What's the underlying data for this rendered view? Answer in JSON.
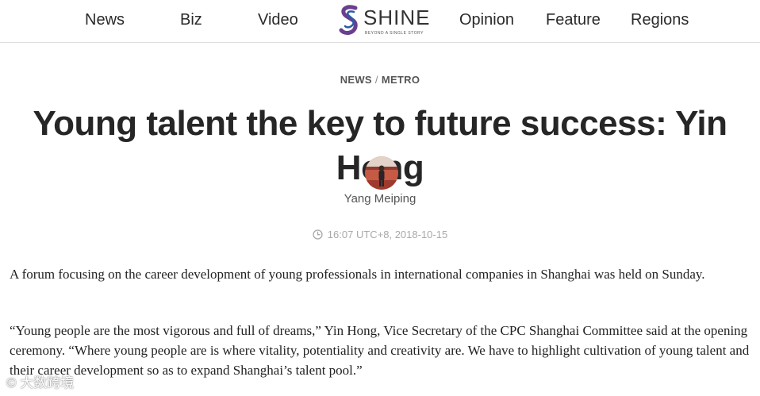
{
  "nav": {
    "left": [
      "News",
      "Biz",
      "Video"
    ],
    "right": [
      "Opinion",
      "Feature",
      "Regions"
    ],
    "logo": {
      "word": "SHINE",
      "tagline": "BEYOND A SINGLE STORY"
    }
  },
  "breadcrumb": {
    "section": "NEWS",
    "separator": "/",
    "subsection": "METRO"
  },
  "article": {
    "title": "Young talent the key to future success: Yin Hong",
    "author": "Yang Meiping",
    "timestamp": "16:07 UTC+8, 2018-10-15",
    "paragraphs": [
      "A forum focusing on the career development of young professionals in international companies in Shanghai was held on Sunday.",
      "“Young people are the most vigorous and full of dreams,” Yin Hong, Vice Secretary of the CPC Shanghai Committee said at the opening ceremony. “Where young people are is where vitality, potentiality and creativity are. We have to highlight cultivation of young talent and their career development so as to expand Shanghai’s talent pool.”"
    ]
  },
  "watermark": "大数跨境",
  "colors": {
    "logo_purple": "#6a3f8e",
    "logo_blue": "#2a5caa",
    "text": "#222222",
    "muted": "#a9a9a9"
  }
}
